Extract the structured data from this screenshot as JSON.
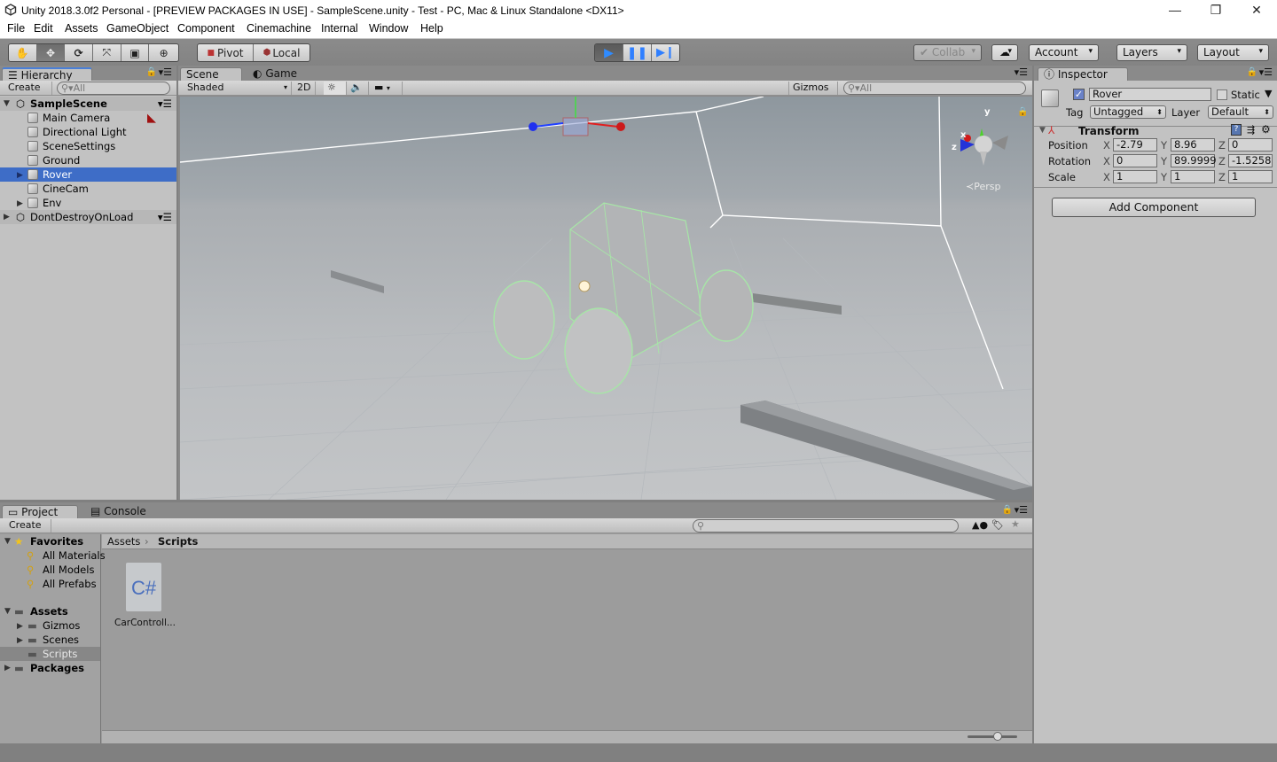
{
  "window": {
    "title": "Unity 2018.3.0f2 Personal - [PREVIEW PACKAGES IN USE] - SampleScene.unity - Test - PC, Mac & Linux Standalone <DX11>",
    "controls": [
      "minimize-icon",
      "restore-icon",
      "close-icon"
    ]
  },
  "menu": [
    "File",
    "Edit",
    "Assets",
    "GameObject",
    "Component",
    "Cinemachine",
    "Internal",
    "Window",
    "Help"
  ],
  "toolbar": {
    "tools": [
      "hand-tool-icon",
      "move-tool-icon",
      "rotate-tool-icon",
      "scale-tool-icon",
      "rect-tool-icon",
      "transform-tool-icon"
    ],
    "active_tool": "move",
    "pivot_label": "Pivot",
    "local_label": "Local",
    "play": [
      "play-icon",
      "pause-icon",
      "step-icon"
    ],
    "collab_label": "Collab",
    "account_label": "Account",
    "layers_label": "Layers",
    "layout_label": "Layout",
    "accent": "#3e6dc7"
  },
  "hierarchy": {
    "tab_label": "Hierarchy",
    "create_label": "Create",
    "search_placeholder": "All",
    "scene_name": "SampleScene",
    "items": [
      {
        "label": "Main Camera",
        "expandable": false
      },
      {
        "label": "Directional Light",
        "expandable": false
      },
      {
        "label": "SceneSettings",
        "expandable": false
      },
      {
        "label": "Ground",
        "expandable": false
      },
      {
        "label": "Rover",
        "expandable": true,
        "selected": true
      },
      {
        "label": "CineCam",
        "expandable": false
      },
      {
        "label": "Env",
        "expandable": true
      }
    ],
    "dont_destroy_label": "DontDestroyOnLoad"
  },
  "scene_view": {
    "tabs": [
      {
        "label": "Scene",
        "active": true
      },
      {
        "label": "Game",
        "active": false
      }
    ],
    "shading_mode": "Shaded",
    "mode_2d_label": "2D",
    "gizmos_label": "Gizmos",
    "search_placeholder": "All",
    "projection_label": "Persp",
    "axis_labels": {
      "x": "x",
      "y": "y",
      "z": "z"
    }
  },
  "inspector": {
    "tab_label": "Inspector",
    "object_name": "Rover",
    "active": true,
    "static_label": "Static",
    "static_checked": false,
    "tag_label": "Tag",
    "tag_value": "Untagged",
    "layer_label": "Layer",
    "layer_value": "Default",
    "transform": {
      "title": "Transform",
      "rows": [
        {
          "label": "Position",
          "x": "-2.79",
          "y": "8.96",
          "z": "0"
        },
        {
          "label": "Rotation",
          "x": "0",
          "y": "89.9999",
          "z": "-1.5258"
        },
        {
          "label": "Scale",
          "x": "1",
          "y": "1",
          "z": "1"
        }
      ],
      "axis_x": "X",
      "axis_y": "Y",
      "axis_z": "Z"
    },
    "add_component_label": "Add Component"
  },
  "project": {
    "tabs": [
      {
        "label": "Project",
        "active": true
      },
      {
        "label": "Console",
        "active": false
      }
    ],
    "create_label": "Create",
    "favorites_label": "Favorites",
    "favorites": [
      "All Materials",
      "All Models",
      "All Prefabs"
    ],
    "assets_label": "Assets",
    "asset_folders": [
      {
        "label": "Gizmos",
        "expandable": true
      },
      {
        "label": "Scenes",
        "expandable": true
      },
      {
        "label": "Scripts",
        "expandable": false,
        "selected": true
      }
    ],
    "packages_label": "Packages",
    "breadcrumb": [
      "Assets",
      "Scripts"
    ],
    "files": [
      {
        "name": "CarControll...",
        "type_glyph": "C#"
      }
    ],
    "zoom_slider_fraction": 0.6
  }
}
